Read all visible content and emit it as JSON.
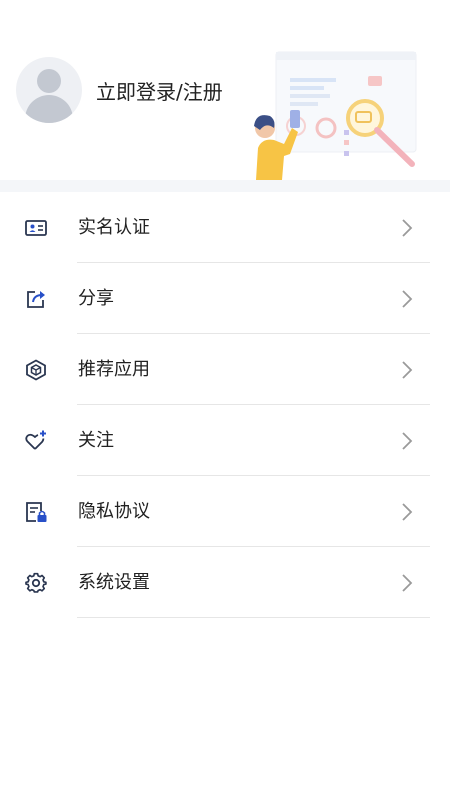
{
  "header": {
    "login_label": "立即登录/注册",
    "avatar_icon": "default-user-avatar",
    "illustration": "person-with-magnifier-illustration"
  },
  "menu": [
    {
      "label": "实名认证",
      "icon": "id-card-icon"
    },
    {
      "label": "分享",
      "icon": "share-icon"
    },
    {
      "label": "推荐应用",
      "icon": "cube-icon"
    },
    {
      "label": "关注",
      "icon": "heart-plus-icon"
    },
    {
      "label": "隐私协议",
      "icon": "document-lock-icon"
    },
    {
      "label": "系统设置",
      "icon": "gear-icon"
    }
  ],
  "colors": {
    "icon": "#2a3650",
    "accent": "#2850c8",
    "chevron": "#9a9a9a",
    "separator": "#e6e6e6",
    "band": "#f4f6f9"
  }
}
